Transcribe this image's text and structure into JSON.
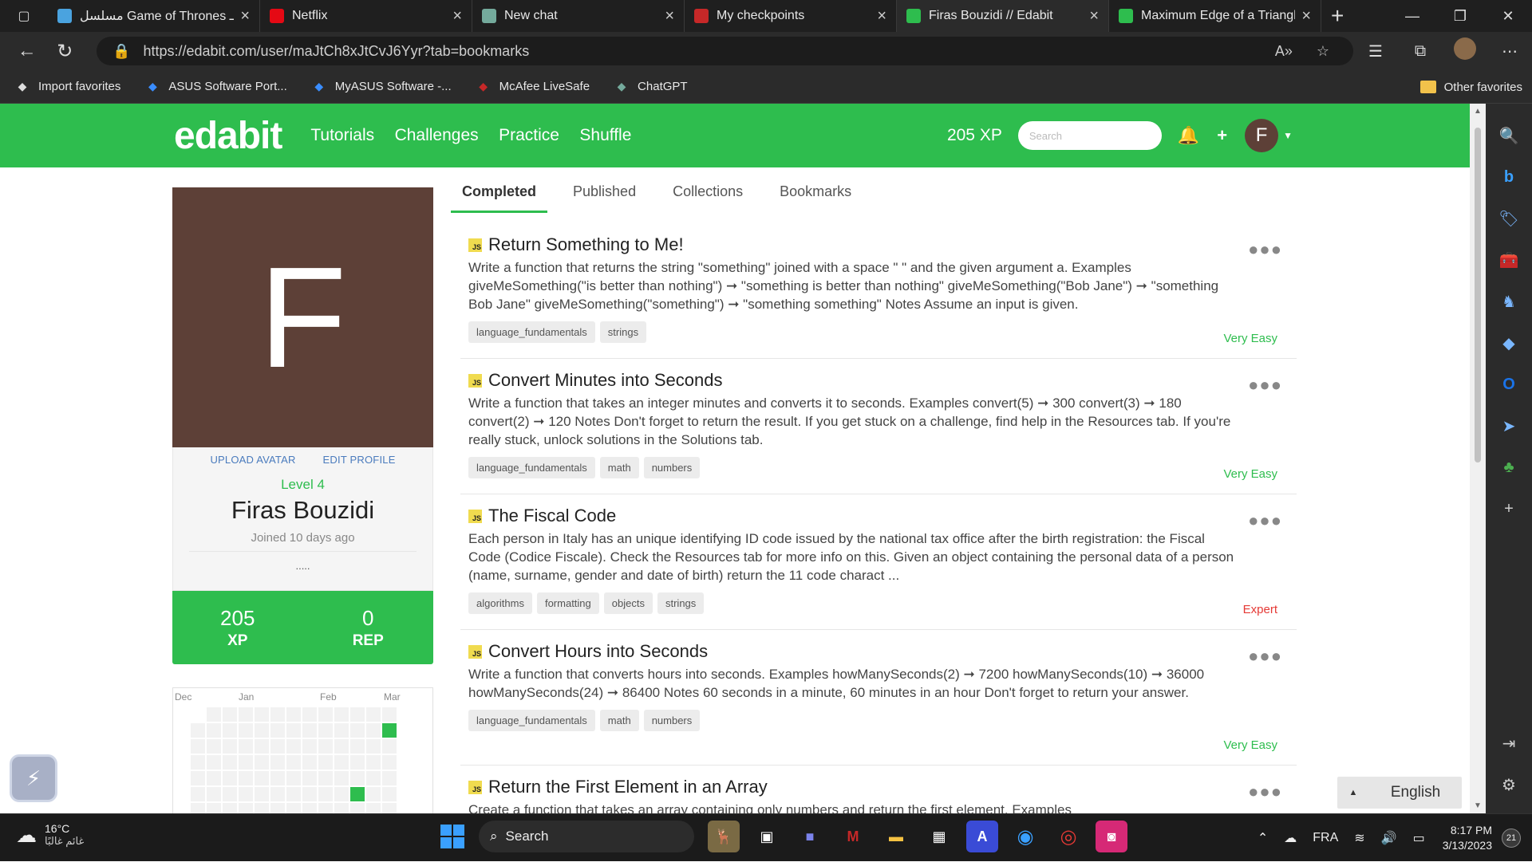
{
  "browser": {
    "tabs": [
      {
        "title": "مسلسل Game of Thrones الـ",
        "icon_color": "#4aa3df",
        "icon": "location-pin-icon",
        "active": false
      },
      {
        "title": "Netflix",
        "icon_color": "#e50914",
        "icon": "netflix-icon",
        "active": false
      },
      {
        "title": "New chat",
        "icon_color": "#74aa9c",
        "icon": "chatgpt-icon",
        "active": false
      },
      {
        "title": "My checkpoints",
        "icon_color": "#c62828",
        "icon": "checkpoint-icon",
        "active": false
      },
      {
        "title": "Firas Bouzidi // Edabit",
        "icon_color": "#2ebd4e",
        "icon": "edabit-icon",
        "active": true
      },
      {
        "title": "Maximum Edge of a Triangle",
        "icon_color": "#2ebd4e",
        "icon": "edabit-icon",
        "active": false
      }
    ],
    "url": "https://edabit.com/user/maJtCh8xJtCvJ6Yyr?tab=bookmarks",
    "favorites": [
      {
        "label": "Import favorites",
        "icon": "import-icon"
      },
      {
        "label": "ASUS Software Port...",
        "icon": "asus-icon"
      },
      {
        "label": "MyASUS Software -...",
        "icon": "asus-icon"
      },
      {
        "label": "McAfee LiveSafe",
        "icon": "mcafee-icon"
      },
      {
        "label": "ChatGPT",
        "icon": "chatgpt-icon"
      }
    ],
    "other_favorites": "Other favorites"
  },
  "edabit": {
    "logo": "edabit",
    "nav": [
      "Tutorials",
      "Challenges",
      "Practice",
      "Shuffle"
    ],
    "xp": "205 XP",
    "search_placeholder": "Search",
    "avatar_letter": "F",
    "accent": "#2ebd4e"
  },
  "profile": {
    "avatar_letter": "F",
    "upload_avatar": "UPLOAD AVATAR",
    "edit_profile": "EDIT PROFILE",
    "level": "Level 4",
    "name": "Firas Bouzidi",
    "joined": "Joined 10 days ago",
    "bio": ".....",
    "xp_value": "205",
    "xp_label": "XP",
    "rep_value": "0",
    "rep_label": "REP",
    "heatmap_months": [
      "Dec",
      "Jan",
      "Feb",
      "Mar"
    ]
  },
  "tabs": [
    "Completed",
    "Published",
    "Collections",
    "Bookmarks"
  ],
  "challenges": [
    {
      "lang": "JS",
      "title": "Return Something to Me!",
      "description": "Write a function that returns the string \"something\" joined with a space \" \" and the given argument a. Examples giveMeSomething(\"is better than nothing\") ➞ \"something is better than nothing\" giveMeSomething(\"Bob Jane\") ➞ \"something Bob Jane\" giveMeSomething(\"something\") ➞ \"something something\" Notes Assume an input is given.",
      "tags": [
        "language_fundamentals",
        "strings"
      ],
      "difficulty": "Very Easy"
    },
    {
      "lang": "JS",
      "title": "Convert Minutes into Seconds",
      "description": "Write a function that takes an integer minutes and converts it to seconds. Examples convert(5) ➞ 300 convert(3) ➞ 180 convert(2) ➞ 120 Notes Don't forget to return the result. If you get stuck on a challenge, find help in the Resources tab. If you're really stuck, unlock solutions in the Solutions tab.",
      "tags": [
        "language_fundamentals",
        "math",
        "numbers"
      ],
      "difficulty": "Very Easy"
    },
    {
      "lang": "JS",
      "title": "The Fiscal Code",
      "description": "Each person in Italy has an unique identifying ID code issued by the national tax office after the birth registration: the Fiscal Code (Codice Fiscale). Check the Resources tab for more info on this. Given an object containing the personal data of a person (name, surname, gender and date of birth) return the 11 code charact ...",
      "tags": [
        "algorithms",
        "formatting",
        "objects",
        "strings"
      ],
      "difficulty": "Expert"
    },
    {
      "lang": "JS",
      "title": "Convert Hours into Seconds",
      "description": "Write a function that converts hours into seconds. Examples howManySeconds(2) ➞ 7200 howManySeconds(10) ➞ 36000 howManySeconds(24) ➞ 86400 Notes 60 seconds in a minute, 60 minutes in an hour Don't forget to return your answer.",
      "tags": [
        "language_fundamentals",
        "math",
        "numbers"
      ],
      "difficulty": "Very Easy"
    },
    {
      "lang": "JS",
      "title": "Return the First Element in an Array",
      "description": "Create a function that takes an array containing only numbers and return the first element. Examples",
      "tags": [],
      "difficulty": ""
    }
  ],
  "language_button": "English",
  "taskbar": {
    "temperature": "16°C",
    "weather": "غائم غالبًا",
    "search": "Search",
    "lang": "FRA",
    "time": "8:17 PM",
    "date": "3/13/2023",
    "notifications": "21"
  }
}
